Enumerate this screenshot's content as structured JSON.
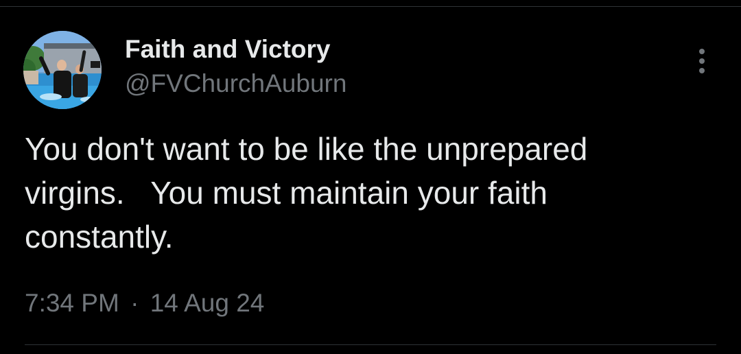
{
  "tweet": {
    "author": {
      "display_name": "Faith and Victory",
      "handle": "@FVChurchAuburn",
      "avatar_icon": "avatar-photo"
    },
    "text": "You don't want to be like the unprepared\nvirgins.   You must maintain your faith\nconstantly.",
    "time": "7:34 PM",
    "separator": "·",
    "date": "14 Aug 24",
    "more_icon": "more-options-icon"
  },
  "colors": {
    "background": "#000000",
    "primary_text": "#e7e9ea",
    "secondary_text": "#71767b",
    "divider": "#2f3336"
  }
}
